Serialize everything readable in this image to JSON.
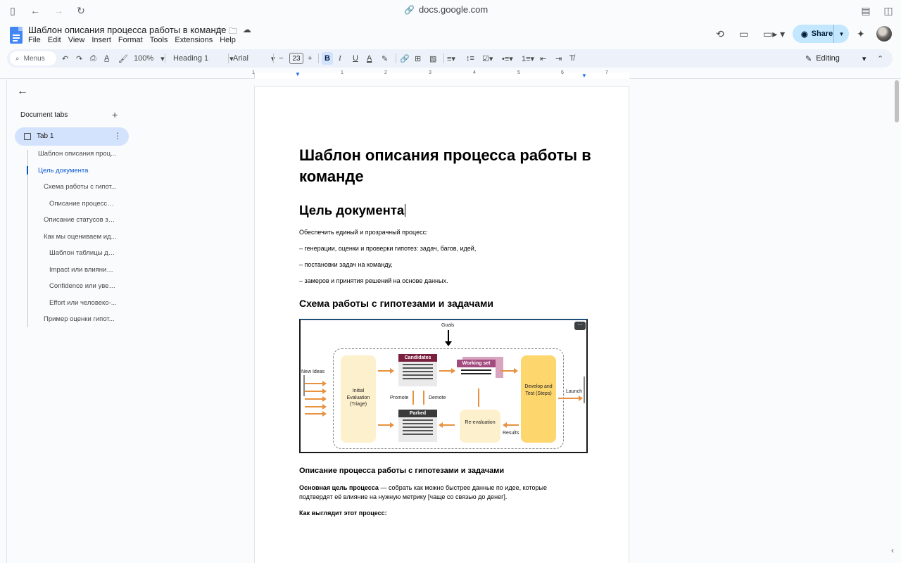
{
  "browser": {
    "url": "docs.google.com"
  },
  "document": {
    "title": "Шаблон описания процесса работы в команде"
  },
  "menu": [
    "File",
    "Edit",
    "View",
    "Insert",
    "Format",
    "Tools",
    "Extensions",
    "Help"
  ],
  "header": {
    "share_label": "Share"
  },
  "toolbar": {
    "search_label": "Menus",
    "zoom": "100%",
    "style": "Heading 1",
    "font": "Arial",
    "font_size": "23",
    "bold_label": "B",
    "mode": "Editing"
  },
  "ruler": {
    "marks": [
      "1",
      "1",
      "2",
      "3",
      "4",
      "5",
      "6",
      "7"
    ]
  },
  "sidebar": {
    "heading": "Document tabs",
    "tab_label": "Tab 1",
    "outline": [
      {
        "label": "Шаблон описания проц...",
        "level": 1,
        "active": false
      },
      {
        "label": "Цель документа",
        "level": 1,
        "active": true
      },
      {
        "label": "Схема работы с гипот...",
        "level": 2,
        "active": false
      },
      {
        "label": "Описание процесса ...",
        "level": 3,
        "active": false
      },
      {
        "label": "Описание статусов за...",
        "level": 2,
        "active": false
      },
      {
        "label": "Как мы оцениваем ид...",
        "level": 2,
        "active": false
      },
      {
        "label": "Шаблон таблицы дл...",
        "level": 3,
        "active": false
      },
      {
        "label": "Impact или влияние ...",
        "level": 3,
        "active": false
      },
      {
        "label": "Confidence или увер...",
        "level": 3,
        "active": false
      },
      {
        "label": "Effort или человеко-...",
        "level": 3,
        "active": false
      },
      {
        "label": "Пример оценки гипот...",
        "level": 2,
        "active": false
      }
    ]
  },
  "page": {
    "title": "Шаблон описания процесса работы в команде",
    "h1": "Цель документа",
    "paragraphs": [
      "Обеспечить единый и прозрачный процесс:",
      "– генерации, оценки и проверки гипотез: задач, багов, идей,",
      "– постановки задач на команду,",
      "– замеров и принятия решений на основе данных."
    ],
    "h2": "Схема работы с гипотезами и задачами",
    "h3": "Описание процесса работы с гипотезами и задачами",
    "para_bold": "Основная цель процесса",
    "para_rest": " — собрать как можно быстрее данные по идее, которые подтвердят её влияние на нужную метрику [чаще со связью до денег].",
    "h4": "Как выглядит этот процесс:"
  },
  "diagram": {
    "goals": "Goals",
    "new_ideas": "New Ideas",
    "triage": "Initial Evaluation (Triage)",
    "candidates": "Candidates",
    "working_set": "Working set",
    "develop": "Develop and Test (Steps)",
    "launch": "Launch",
    "promote": "Promote",
    "demote": "Demote",
    "parked": "Parked",
    "reevaluation": "Re-evaluation",
    "results": "Results"
  }
}
